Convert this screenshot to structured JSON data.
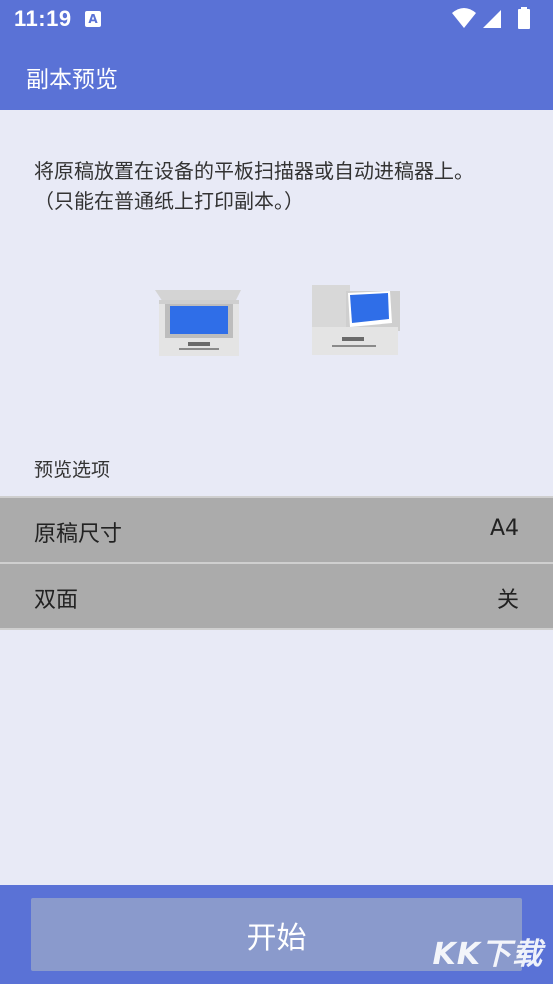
{
  "status_bar": {
    "time": "11:19",
    "notification_icon": "A",
    "icons": [
      "wifi-icon",
      "signal-icon",
      "battery-icon"
    ]
  },
  "app_bar": {
    "title": "副本预览"
  },
  "instructions": {
    "line1": "将原稿放置在设备的平板扫描器或自动进稿器上。",
    "line2": "（只能在普通纸上打印副本。）"
  },
  "illustrations": [
    "flatbed-scanner-icon",
    "adf-scanner-icon"
  ],
  "preview_options": {
    "label": "预览选项",
    "items": [
      {
        "label": "原稿尺寸",
        "value": "A4"
      },
      {
        "label": "双面",
        "value": "关"
      }
    ]
  },
  "footer": {
    "start_label": "开始",
    "watermark": "KK下载"
  },
  "colors": {
    "primary": "#5a72d6",
    "background": "#e8eaf6",
    "row_bg": "#ababab",
    "button_bg": "#8a9acc",
    "screen_blue": "#2f6ee8"
  }
}
